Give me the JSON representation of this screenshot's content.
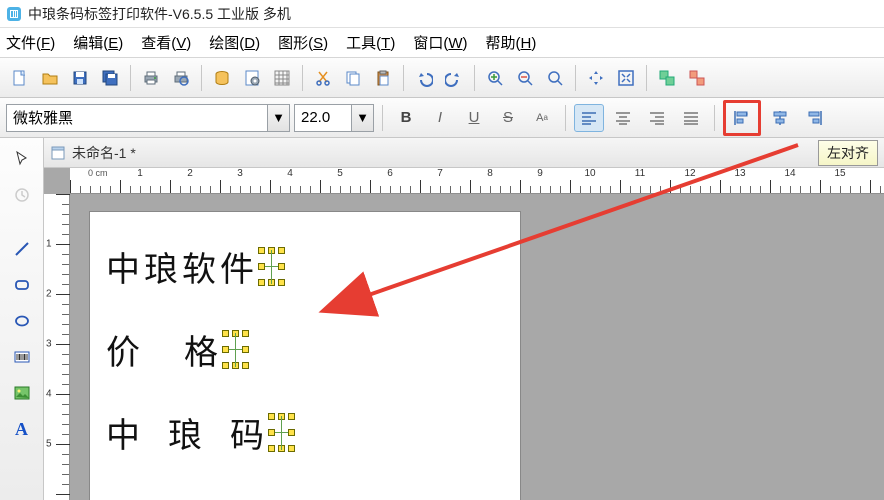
{
  "titlebar": {
    "title": "中琅条码标签打印软件-V6.5.5 工业版 多机"
  },
  "menu": {
    "file": "文件",
    "file_k": "F",
    "edit": "编辑",
    "edit_k": "E",
    "view": "查看",
    "view_k": "V",
    "draw": "绘图",
    "draw_k": "D",
    "shape": "图形",
    "shape_k": "S",
    "tool": "工具",
    "tool_k": "T",
    "window": "窗口",
    "window_k": "W",
    "help": "帮助",
    "help_k": "H"
  },
  "font": {
    "name": "微软雅黑",
    "size": "22.0"
  },
  "doc": {
    "tab_title": "未命名-1 *",
    "tooltip": "左对齐"
  },
  "ruler": {
    "unit": "cm",
    "h_labels": [
      "0",
      "1",
      "2",
      "3",
      "4",
      "5",
      "6",
      "7",
      "8",
      "9",
      "10",
      "11",
      "12",
      "13",
      "14",
      "15"
    ],
    "v_labels": [
      "1",
      "2",
      "3",
      "4",
      "5"
    ]
  },
  "canvas": {
    "lines": [
      "中琅软件",
      "价格",
      "中琅码"
    ]
  },
  "textstyle": {
    "bold": "B",
    "italic": "I",
    "underline": "U",
    "strike": "S",
    "super": "A",
    "sub": "a"
  }
}
